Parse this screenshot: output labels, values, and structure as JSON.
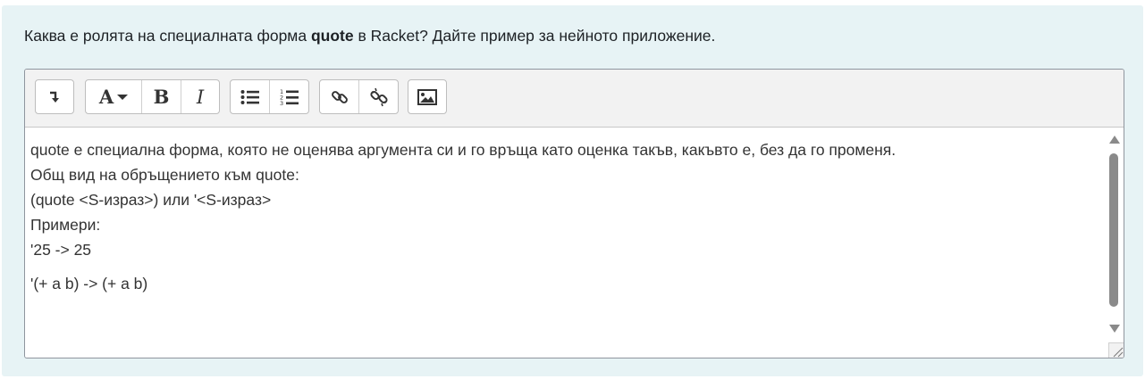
{
  "question": {
    "prefix": "Каква е ролята на специалната форма ",
    "keyword": "quote",
    "suffix": " в Racket? Дайте пример за нейното приложение."
  },
  "toolbar": {
    "buttons": [
      {
        "name": "collapse",
        "icon": "collapse-toolbar-icon"
      },
      {
        "name": "font-style",
        "icon": "font-style-icon",
        "label": "A"
      },
      {
        "name": "bold",
        "icon": "bold-icon",
        "label": "B"
      },
      {
        "name": "italic",
        "icon": "italic-icon",
        "label": "I"
      },
      {
        "name": "unordered-list",
        "icon": "unordered-list-icon"
      },
      {
        "name": "ordered-list",
        "icon": "ordered-list-icon"
      },
      {
        "name": "link",
        "icon": "link-icon"
      },
      {
        "name": "unlink",
        "icon": "unlink-icon"
      },
      {
        "name": "image",
        "icon": "image-icon"
      }
    ]
  },
  "answer": {
    "lines": [
      "quote е специална форма, която не оценява аргумента си и го връща като оценка такъв, какъвто е, без да го променя.",
      "Общ вид на обръщението към quote:",
      "(quote <S-израз>) или '<S-израз>",
      "Примери:",
      "'25 -> 25",
      "'(+ a b) -> (+ a b)"
    ]
  },
  "colors": {
    "panel_bg": "#e7f3f5",
    "toolbar_bg": "#f2f2f2",
    "text": "#1d2125"
  }
}
